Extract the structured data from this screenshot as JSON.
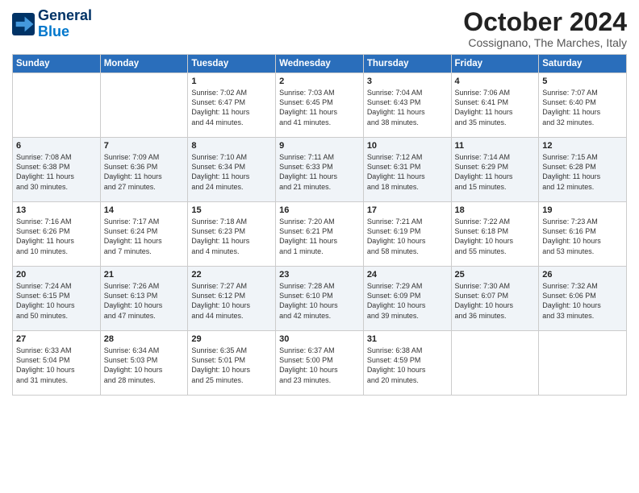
{
  "logo": {
    "line1": "General",
    "line2": "Blue"
  },
  "title": "October 2024",
  "subtitle": "Cossignano, The Marches, Italy",
  "weekdays": [
    "Sunday",
    "Monday",
    "Tuesday",
    "Wednesday",
    "Thursday",
    "Friday",
    "Saturday"
  ],
  "weeks": [
    [
      {
        "day": "",
        "info": ""
      },
      {
        "day": "",
        "info": ""
      },
      {
        "day": "1",
        "info": "Sunrise: 7:02 AM\nSunset: 6:47 PM\nDaylight: 11 hours\nand 44 minutes."
      },
      {
        "day": "2",
        "info": "Sunrise: 7:03 AM\nSunset: 6:45 PM\nDaylight: 11 hours\nand 41 minutes."
      },
      {
        "day": "3",
        "info": "Sunrise: 7:04 AM\nSunset: 6:43 PM\nDaylight: 11 hours\nand 38 minutes."
      },
      {
        "day": "4",
        "info": "Sunrise: 7:06 AM\nSunset: 6:41 PM\nDaylight: 11 hours\nand 35 minutes."
      },
      {
        "day": "5",
        "info": "Sunrise: 7:07 AM\nSunset: 6:40 PM\nDaylight: 11 hours\nand 32 minutes."
      }
    ],
    [
      {
        "day": "6",
        "info": "Sunrise: 7:08 AM\nSunset: 6:38 PM\nDaylight: 11 hours\nand 30 minutes."
      },
      {
        "day": "7",
        "info": "Sunrise: 7:09 AM\nSunset: 6:36 PM\nDaylight: 11 hours\nand 27 minutes."
      },
      {
        "day": "8",
        "info": "Sunrise: 7:10 AM\nSunset: 6:34 PM\nDaylight: 11 hours\nand 24 minutes."
      },
      {
        "day": "9",
        "info": "Sunrise: 7:11 AM\nSunset: 6:33 PM\nDaylight: 11 hours\nand 21 minutes."
      },
      {
        "day": "10",
        "info": "Sunrise: 7:12 AM\nSunset: 6:31 PM\nDaylight: 11 hours\nand 18 minutes."
      },
      {
        "day": "11",
        "info": "Sunrise: 7:14 AM\nSunset: 6:29 PM\nDaylight: 11 hours\nand 15 minutes."
      },
      {
        "day": "12",
        "info": "Sunrise: 7:15 AM\nSunset: 6:28 PM\nDaylight: 11 hours\nand 12 minutes."
      }
    ],
    [
      {
        "day": "13",
        "info": "Sunrise: 7:16 AM\nSunset: 6:26 PM\nDaylight: 11 hours\nand 10 minutes."
      },
      {
        "day": "14",
        "info": "Sunrise: 7:17 AM\nSunset: 6:24 PM\nDaylight: 11 hours\nand 7 minutes."
      },
      {
        "day": "15",
        "info": "Sunrise: 7:18 AM\nSunset: 6:23 PM\nDaylight: 11 hours\nand 4 minutes."
      },
      {
        "day": "16",
        "info": "Sunrise: 7:20 AM\nSunset: 6:21 PM\nDaylight: 11 hours\nand 1 minute."
      },
      {
        "day": "17",
        "info": "Sunrise: 7:21 AM\nSunset: 6:19 PM\nDaylight: 10 hours\nand 58 minutes."
      },
      {
        "day": "18",
        "info": "Sunrise: 7:22 AM\nSunset: 6:18 PM\nDaylight: 10 hours\nand 55 minutes."
      },
      {
        "day": "19",
        "info": "Sunrise: 7:23 AM\nSunset: 6:16 PM\nDaylight: 10 hours\nand 53 minutes."
      }
    ],
    [
      {
        "day": "20",
        "info": "Sunrise: 7:24 AM\nSunset: 6:15 PM\nDaylight: 10 hours\nand 50 minutes."
      },
      {
        "day": "21",
        "info": "Sunrise: 7:26 AM\nSunset: 6:13 PM\nDaylight: 10 hours\nand 47 minutes."
      },
      {
        "day": "22",
        "info": "Sunrise: 7:27 AM\nSunset: 6:12 PM\nDaylight: 10 hours\nand 44 minutes."
      },
      {
        "day": "23",
        "info": "Sunrise: 7:28 AM\nSunset: 6:10 PM\nDaylight: 10 hours\nand 42 minutes."
      },
      {
        "day": "24",
        "info": "Sunrise: 7:29 AM\nSunset: 6:09 PM\nDaylight: 10 hours\nand 39 minutes."
      },
      {
        "day": "25",
        "info": "Sunrise: 7:30 AM\nSunset: 6:07 PM\nDaylight: 10 hours\nand 36 minutes."
      },
      {
        "day": "26",
        "info": "Sunrise: 7:32 AM\nSunset: 6:06 PM\nDaylight: 10 hours\nand 33 minutes."
      }
    ],
    [
      {
        "day": "27",
        "info": "Sunrise: 6:33 AM\nSunset: 5:04 PM\nDaylight: 10 hours\nand 31 minutes."
      },
      {
        "day": "28",
        "info": "Sunrise: 6:34 AM\nSunset: 5:03 PM\nDaylight: 10 hours\nand 28 minutes."
      },
      {
        "day": "29",
        "info": "Sunrise: 6:35 AM\nSunset: 5:01 PM\nDaylight: 10 hours\nand 25 minutes."
      },
      {
        "day": "30",
        "info": "Sunrise: 6:37 AM\nSunset: 5:00 PM\nDaylight: 10 hours\nand 23 minutes."
      },
      {
        "day": "31",
        "info": "Sunrise: 6:38 AM\nSunset: 4:59 PM\nDaylight: 10 hours\nand 20 minutes."
      },
      {
        "day": "",
        "info": ""
      },
      {
        "day": "",
        "info": ""
      }
    ]
  ]
}
